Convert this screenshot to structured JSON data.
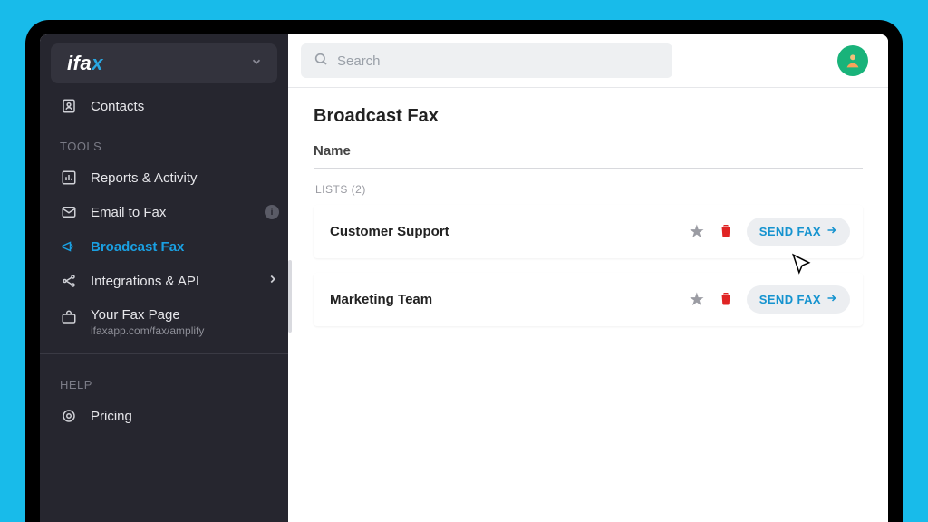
{
  "brand": {
    "prefix": "ifa",
    "suffix": "x"
  },
  "sidebar": {
    "contacts": "Contacts",
    "section_tools": "TOOLS",
    "reports": "Reports & Activity",
    "email_to_fax": "Email to Fax",
    "broadcast": "Broadcast Fax",
    "integrations": "Integrations & API",
    "faxpage_title": "Your Fax Page",
    "faxpage_sub": "ifaxapp.com/fax/amplify",
    "section_help": "HELP",
    "pricing": "Pricing"
  },
  "search": {
    "placeholder": "Search"
  },
  "page": {
    "title": "Broadcast Fax",
    "column": "Name",
    "list_label": "LISTS (2)",
    "send_label": "SEND FAX"
  },
  "lists": [
    {
      "name": "Customer Support"
    },
    {
      "name": "Marketing Team"
    }
  ]
}
